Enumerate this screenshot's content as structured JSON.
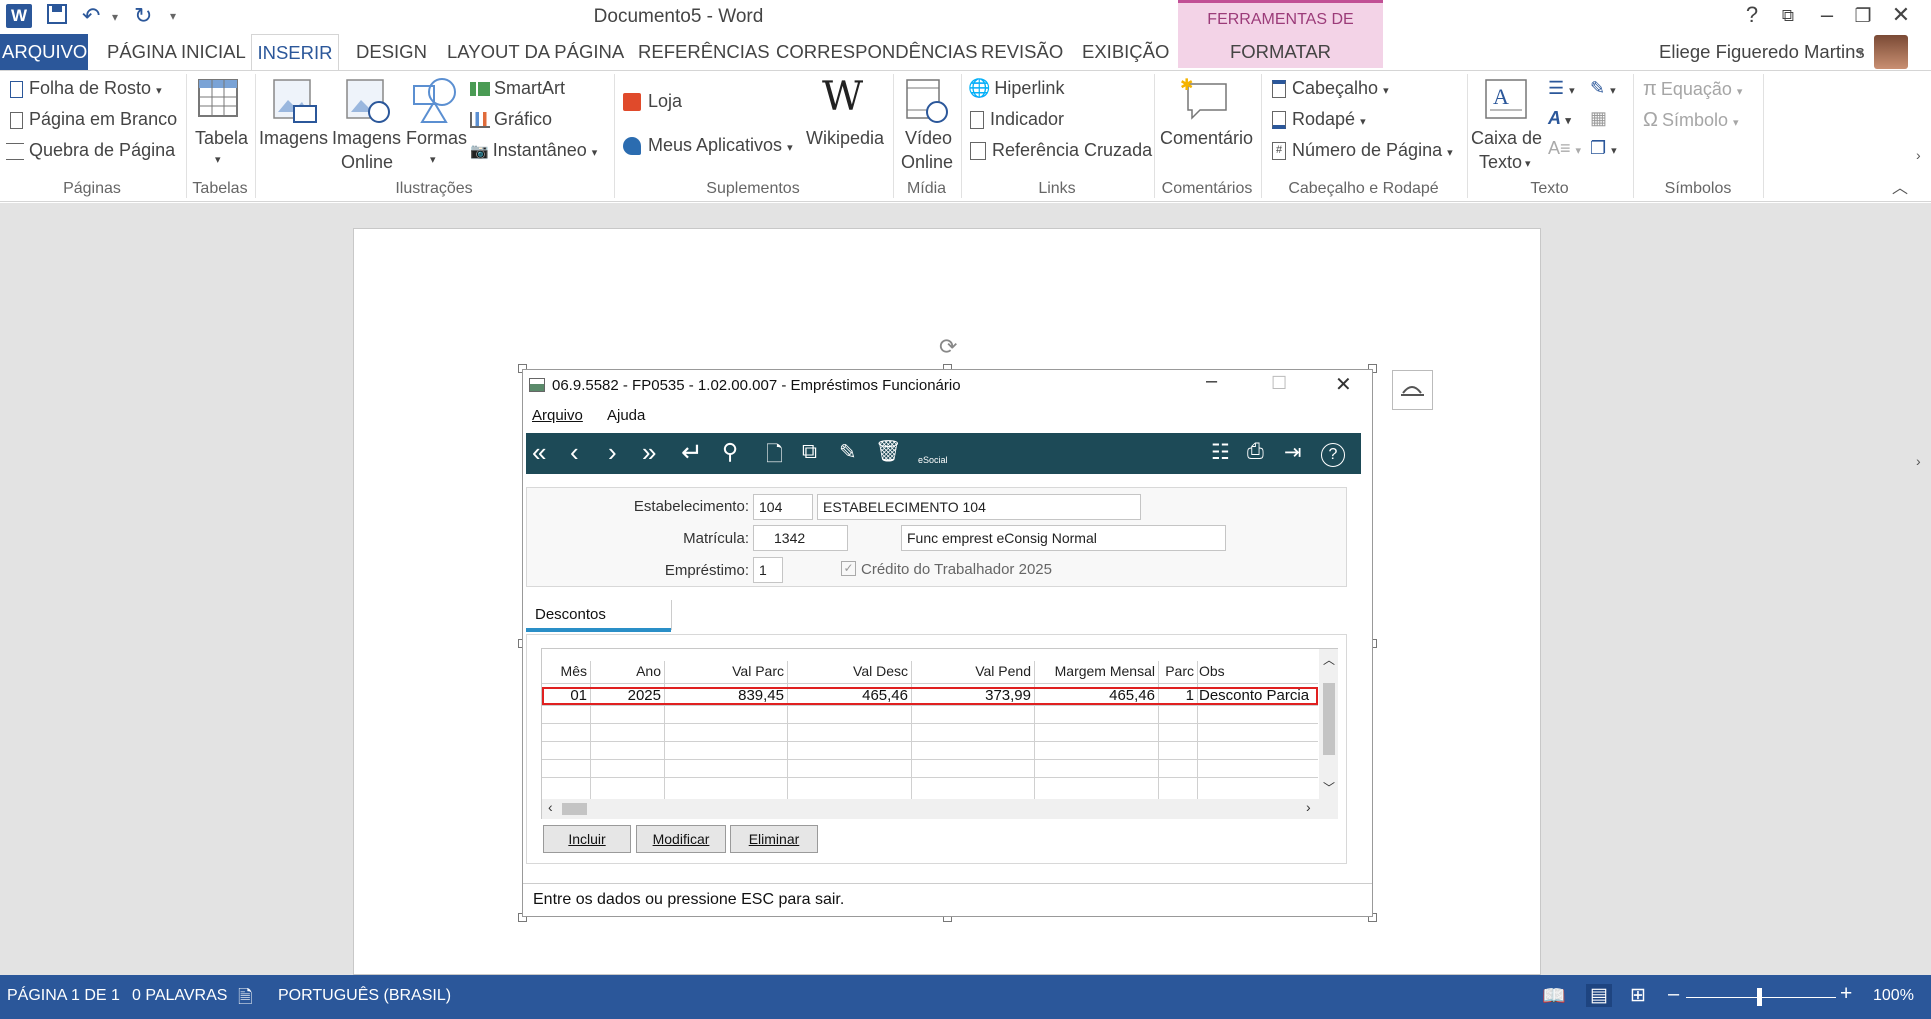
{
  "window": {
    "title": "Documento5 - Word",
    "image_tools_header": "FERRAMENTAS DE IMAGEM",
    "help": "?",
    "user": "Eliege Figueredo Martins"
  },
  "tabs": {
    "arquivo": "ARQUIVO",
    "pagina_inicial": "PÁGINA INICIAL",
    "inserir": "INSERIR",
    "design": "DESIGN",
    "layout": "LAYOUT DA PÁGINA",
    "referencias": "REFERÊNCIAS",
    "correspondencias": "CORRESPONDÊNCIAS",
    "revisao": "REVISÃO",
    "exibicao": "EXIBIÇÃO",
    "formatar": "FORMATAR"
  },
  "ribbon": {
    "paginas": {
      "label": "Páginas",
      "folha": "Folha de Rosto",
      "branco": "Página em Branco",
      "quebra": "Quebra de Página"
    },
    "tabelas": {
      "label": "Tabelas",
      "tabela": "Tabela"
    },
    "ilustracoes": {
      "label": "Ilustrações",
      "imagens": "Imagens",
      "online1": "Imagens",
      "online2": "Online",
      "formas": "Formas",
      "smartart": "SmartArt",
      "grafico": "Gráfico",
      "instantaneo": "Instantâneo"
    },
    "suplementos": {
      "label": "Suplementos",
      "loja": "Loja",
      "meus": "Meus Aplicativos",
      "wikipedia": "Wikipedia"
    },
    "midia": {
      "label": "Mídia",
      "video1": "Vídeo",
      "video2": "Online"
    },
    "links": {
      "label": "Links",
      "hiperlink": "Hiperlink",
      "indicador": "Indicador",
      "referencia": "Referência Cruzada"
    },
    "comentarios": {
      "label": "Comentários",
      "comentario": "Comentário"
    },
    "cabecalho": {
      "label": "Cabeçalho e Rodapé",
      "cabecalho": "Cabeçalho",
      "rodape": "Rodapé",
      "numero": "Número de Página"
    },
    "texto": {
      "label": "Texto",
      "caixa1": "Caixa de",
      "caixa2": "Texto"
    },
    "simbolos": {
      "label": "Símbolos",
      "equacao": "Equação",
      "simbolo": "Símbolo"
    }
  },
  "app": {
    "title": "06.9.5582 - FP0535 - 1.02.00.007 - Empréstimos Funcionário",
    "menu_arquivo": "Arquivo",
    "menu_ajuda": "Ajuda",
    "esocial": "eSocial",
    "estab_label": "Estabelecimento:",
    "estab_code": "104",
    "estab_name": "ESTABELECIMENTO 104",
    "matricula_label": "Matrícula:",
    "matricula_code": "1342",
    "matricula_name": "Func emprest eConsig Normal",
    "emprestimo_label": "Empréstimo:",
    "emprestimo_num": "1",
    "credito": "Crédito do Trabalhador 2025",
    "tab_descontos": "Descontos",
    "columns": [
      "Mês",
      "Ano",
      "Val Parc",
      "Val Desc",
      "Val Pend",
      "Margem Mensal",
      "Parc",
      "Obs"
    ],
    "row": [
      "01",
      "2025",
      "839,45",
      "465,46",
      "373,99",
      "465,46",
      "1",
      "Desconto Parcia"
    ],
    "btn_incluir": "Incluir",
    "btn_modificar": "Modificar",
    "btn_eliminar": "Eliminar",
    "status": "Entre os dados ou pressione ESC para sair.",
    "highlight_color": "#e02020",
    "toolbar_color": "#1d4a57"
  },
  "status": {
    "pagina": "PÁGINA 1 DE 1",
    "palavras": "0 PALAVRAS",
    "idioma": "PORTUGUÊS (BRASIL)",
    "zoom": "100%"
  }
}
